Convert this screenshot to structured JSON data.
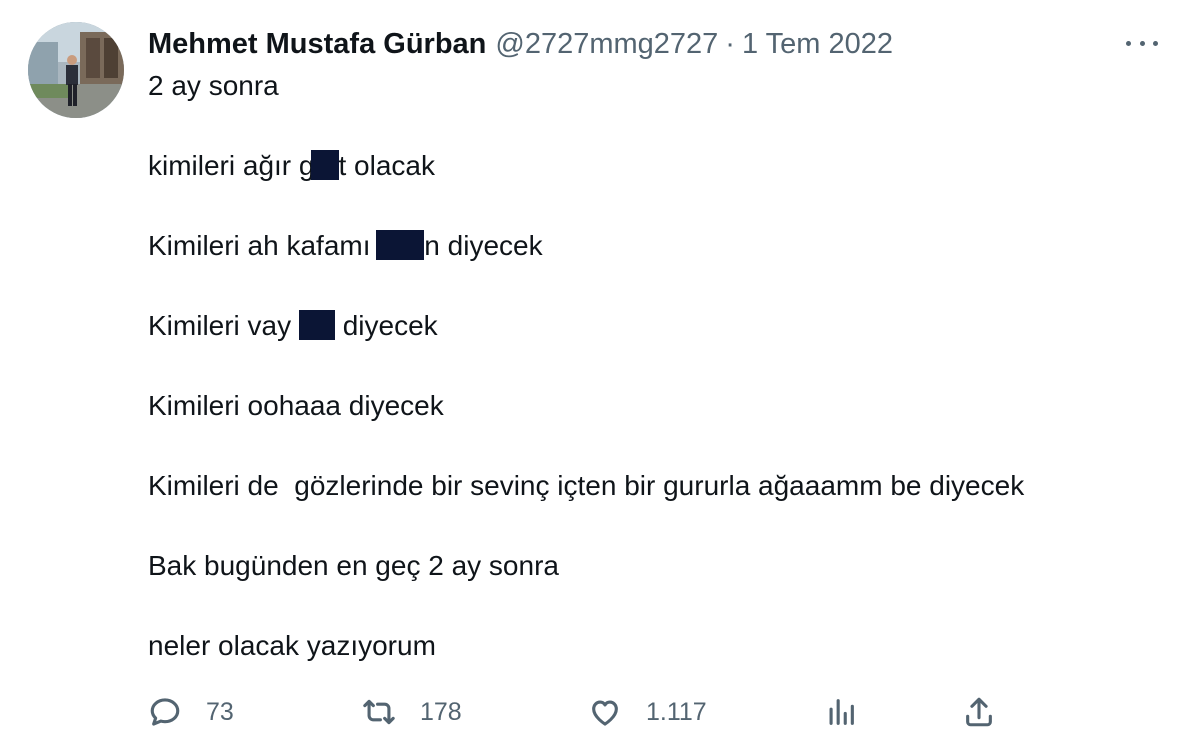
{
  "tweet": {
    "author_name": "Mehmet Mustafa Gürban",
    "handle": "@2727mmg2727",
    "separator": "·",
    "date": "1 Tem 2022",
    "lines": {
      "l0": "2 ay sonra",
      "l1a": "kimileri ağır ",
      "l1b": "g",
      "l1c": "t olacak",
      "l2a": "Kimileri ah kafamı ",
      "l2b": "n diyecek",
      "l3a": "Kimileri vay ",
      "l3b": " diyecek",
      "l4": "Kimileri oohaaa diyecek",
      "l5": "Kimileri de  gözlerinde bir sevinç içten bir gururla ağaaamm be diyecek",
      "l6": "Bak bugünden en geç 2 ay sonra",
      "l7": "neler olacak yazıyorum"
    }
  },
  "actions": {
    "reply_count": "73",
    "retweet_count": "178",
    "like_count": "1.117"
  },
  "icons": {
    "more": "more-horizontal-icon",
    "reply": "reply-icon",
    "retweet": "retweet-icon",
    "like": "heart-icon",
    "views": "analytics-icon",
    "share": "share-icon"
  },
  "colors": {
    "text": "#0f1419",
    "secondary": "#536471",
    "redaction": "#0b1535"
  }
}
